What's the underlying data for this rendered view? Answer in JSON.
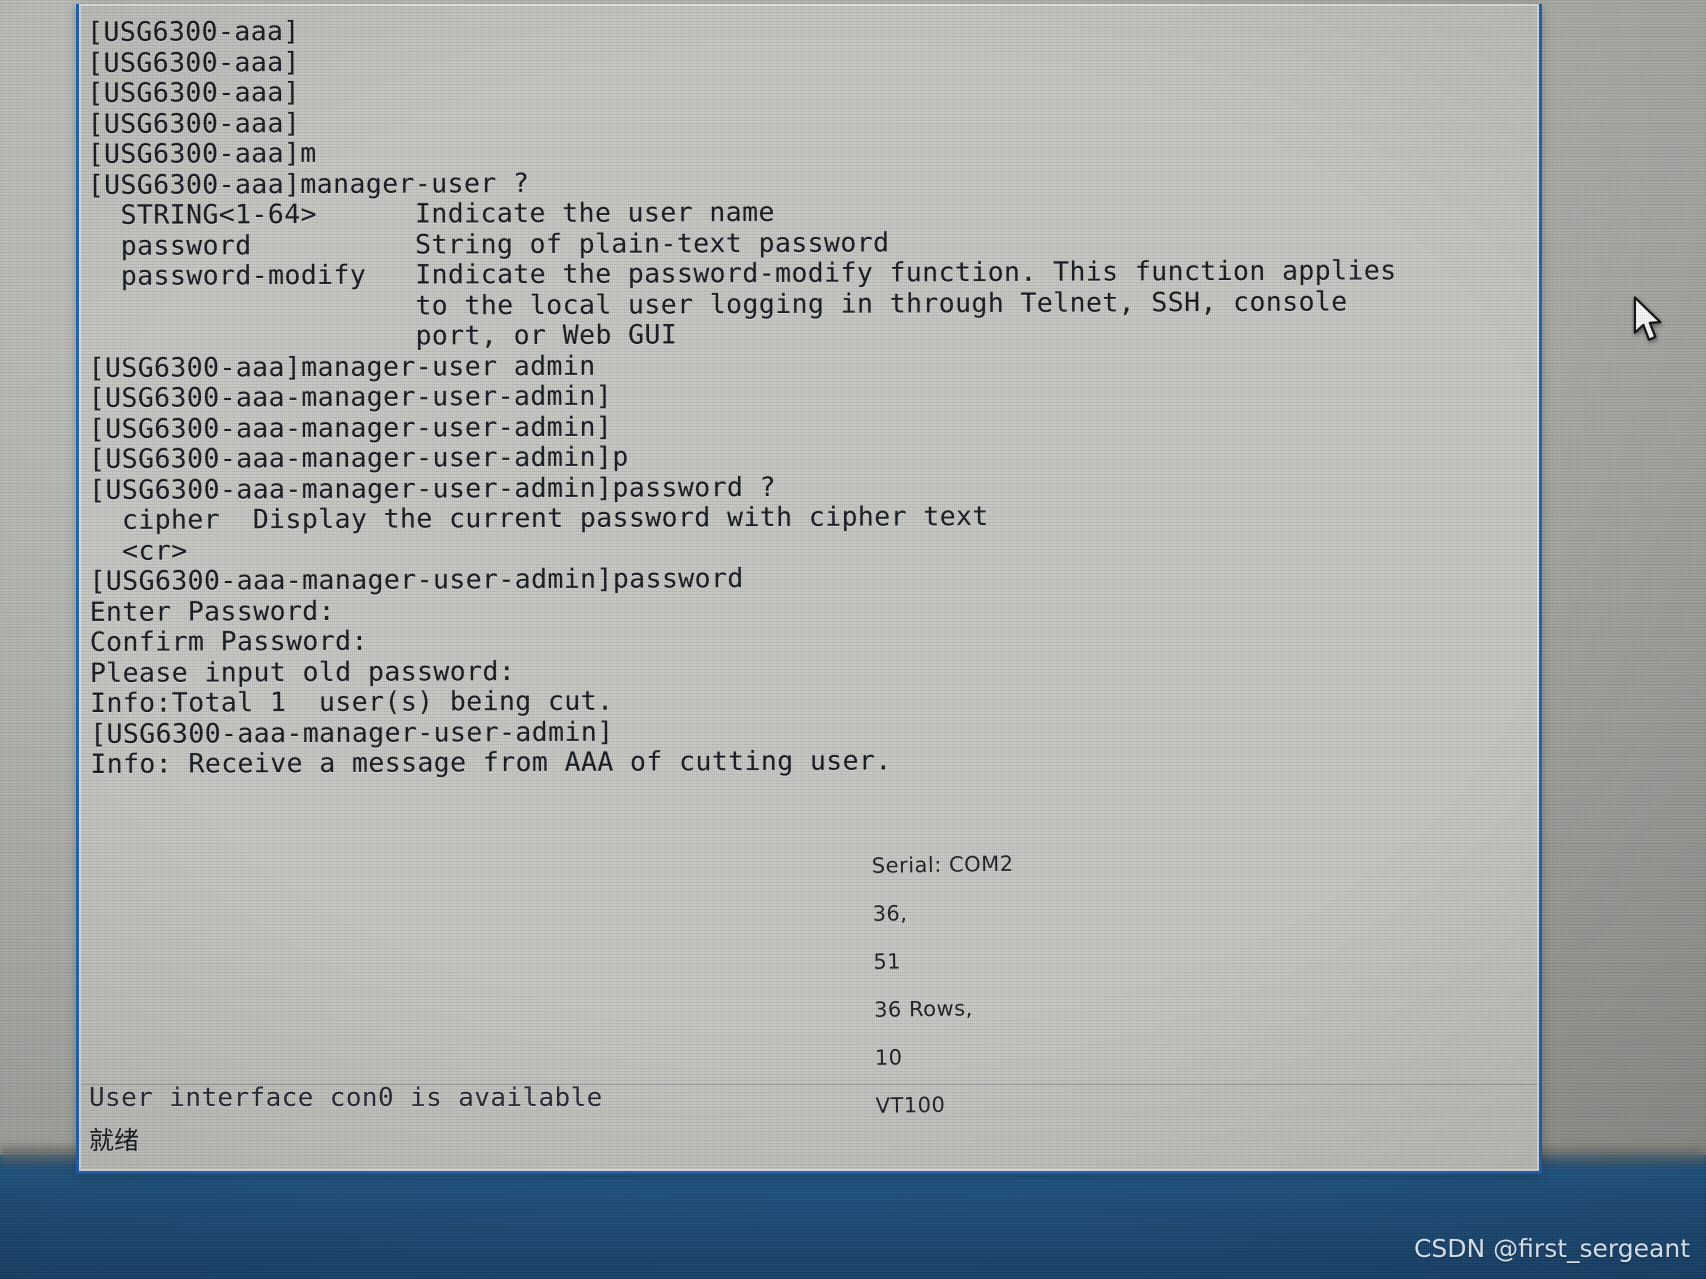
{
  "window": {
    "border_color": "#1663c4",
    "screen_bg": "#c6c7c2",
    "text_color": "#141820"
  },
  "terminal": {
    "lines": [
      "[USG6300-aaa]",
      "[USG6300-aaa]",
      "[USG6300-aaa]",
      "[USG6300-aaa]",
      "[USG6300-aaa]m",
      "[USG6300-aaa]manager-user ?",
      "  STRING<1-64>      Indicate the user name",
      "  password          String of plain-text password",
      "  password-modify   Indicate the password-modify function. This function applies",
      "                    to the local user logging in through Telnet, SSH, console",
      "                    port, or Web GUI",
      "",
      "[USG6300-aaa]manager-user admin",
      "[USG6300-aaa-manager-user-admin]",
      "[USG6300-aaa-manager-user-admin]",
      "[USG6300-aaa-manager-user-admin]p",
      "[USG6300-aaa-manager-user-admin]password ?",
      "  cipher  Display the current password with cipher text",
      "  <cr>",
      "",
      "[USG6300-aaa-manager-user-admin]password",
      "Enter Password:",
      "Confirm Password:",
      "Please input old password:",
      "Info:Total 1  user(s) being cut.",
      "[USG6300-aaa-manager-user-admin]",
      "Info: Receive a message from AAA of cutting user."
    ],
    "available_message": "User interface con0 is available"
  },
  "statusbar": {
    "ready_label": "就绪",
    "connection": "Serial: COM2",
    "cursor_row": "36,",
    "cursor_col": "51",
    "rows": "36 Rows,",
    "cols": "10",
    "emulation": "VT100"
  },
  "cursor": {
    "icon": "mouse-pointer-icon"
  },
  "watermark": {
    "text": "CSDN @first_sergeant"
  }
}
